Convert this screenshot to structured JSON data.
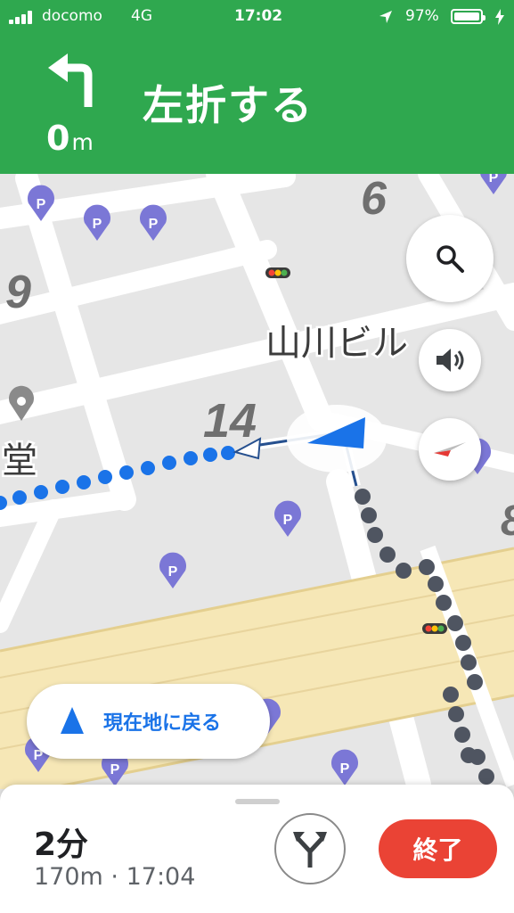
{
  "status_bar": {
    "carrier": "docomo",
    "network": "4G",
    "time": "17:02",
    "battery_percent": "97%"
  },
  "navigation": {
    "distance_value": "0",
    "distance_unit": "m",
    "instruction": "左折する"
  },
  "map": {
    "labels": {
      "block_number_6": "6",
      "block_number_9": "9",
      "block_number_14": "14",
      "block_number_8": "8",
      "building_name": "山川ビル",
      "place_name_partial": "堂"
    },
    "recenter_label": "現在地に戻る"
  },
  "trip": {
    "eta_duration": "2分",
    "summary": "170m · 17:04",
    "exit_label": "終了"
  },
  "colors": {
    "header_green": "#2fa84f",
    "route_blue": "#1a73e8",
    "exit_red": "#ea4335"
  },
  "icons": [
    "signal-bars-icon",
    "location-arrow-icon",
    "battery-icon",
    "charging-bolt-icon",
    "turn-left-icon",
    "search-icon",
    "volume-icon",
    "compass-icon",
    "parking-pin-icon",
    "place-pin-icon",
    "traffic-light-icon",
    "navigation-arrow-icon",
    "alternate-routes-icon"
  ]
}
